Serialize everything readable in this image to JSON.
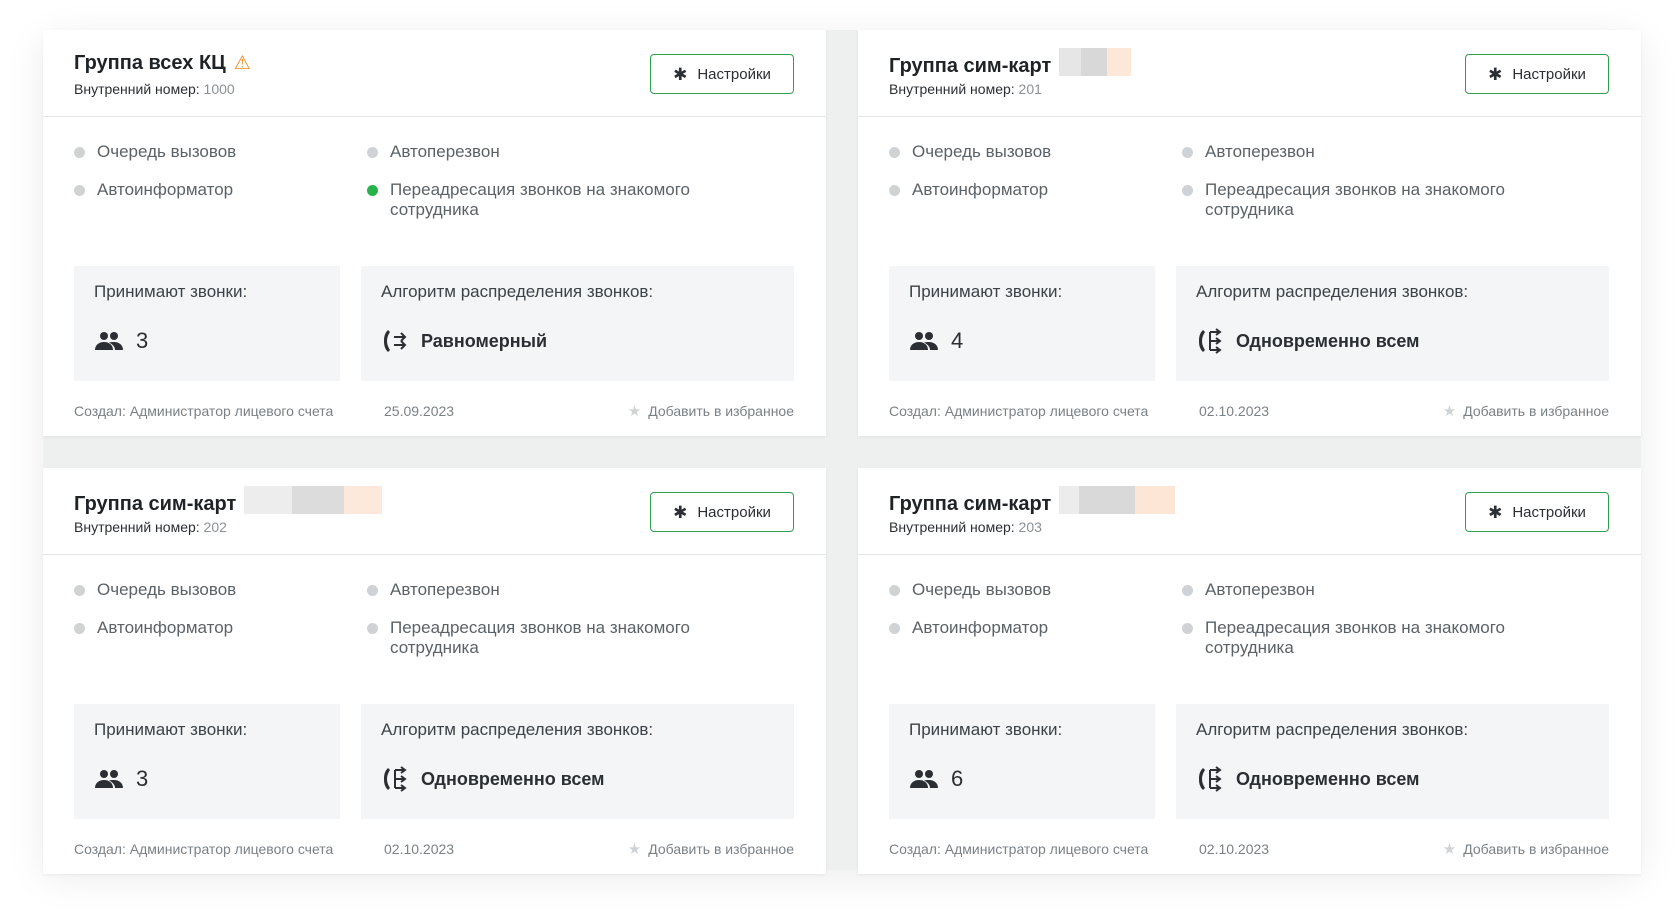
{
  "cards": [
    {
      "title": "Группа всех КЦ",
      "has_warning": true,
      "internal_label": "Внутренний номер:",
      "internal_number": "1000",
      "settings_label": "Настройки",
      "features": [
        {
          "label": "Очередь вызовов",
          "active": false
        },
        {
          "label": "Автоперезвон",
          "active": false
        },
        {
          "label": "Автоинформатор",
          "active": false
        },
        {
          "label": "Переадресация звонков на знакомого сотрудника",
          "active": true
        }
      ],
      "receivers_label": "Принимают звонки:",
      "receivers_count": "3",
      "algorithm_label": "Алгоритм распределения звонков:",
      "algorithm_value": "Равномерный",
      "algorithm_icon": "uniform-distribution-icon",
      "creator": "Создал: Администратор лицевого счета",
      "date": "25.09.2023",
      "favorite_label": "Добавить в избранное"
    },
    {
      "title": "Группа сим-карт",
      "has_warning": false,
      "internal_label": "Внутренний номер:",
      "internal_number": "201",
      "settings_label": "Настройки",
      "features": [
        {
          "label": "Очередь вызовов",
          "active": false
        },
        {
          "label": "Автоперезвон",
          "active": false
        },
        {
          "label": "Автоинформатор",
          "active": false
        },
        {
          "label": "Переадресация звонков на знакомого сотрудника",
          "active": false
        }
      ],
      "receivers_label": "Принимают звонки:",
      "receivers_count": "4",
      "algorithm_label": "Алгоритм распределения звонков:",
      "algorithm_value": "Одновременно всем",
      "algorithm_icon": "simultaneous-distribution-icon",
      "creator": "Создал: Администратор лицевого счета",
      "date": "02.10.2023",
      "favorite_label": "Добавить в избранное"
    },
    {
      "title": "Группа сим-карт",
      "has_warning": false,
      "internal_label": "Внутренний номер:",
      "internal_number": "202",
      "settings_label": "Настройки",
      "features": [
        {
          "label": "Очередь вызовов",
          "active": false
        },
        {
          "label": "Автоперезвон",
          "active": false
        },
        {
          "label": "Автоинформатор",
          "active": false
        },
        {
          "label": "Переадресация звонков на знакомого сотрудника",
          "active": false
        }
      ],
      "receivers_label": "Принимают звонки:",
      "receivers_count": "3",
      "algorithm_label": "Алгоритм распределения звонков:",
      "algorithm_value": "Одновременно всем",
      "algorithm_icon": "simultaneous-distribution-icon",
      "creator": "Создал: Администратор лицевого счета",
      "date": "02.10.2023",
      "favorite_label": "Добавить в избранное"
    },
    {
      "title": "Группа сим-карт",
      "has_warning": false,
      "internal_label": "Внутренний номер:",
      "internal_number": "203",
      "settings_label": "Настройки",
      "features": [
        {
          "label": "Очередь вызовов",
          "active": false
        },
        {
          "label": "Автоперезвон",
          "active": false
        },
        {
          "label": "Автоинформатор",
          "active": false
        },
        {
          "label": "Переадресация звонков на знакомого сотрудника",
          "active": false
        }
      ],
      "receivers_label": "Принимают звонки:",
      "receivers_count": "6",
      "algorithm_label": "Алгоритм распределения звонков:",
      "algorithm_value": "Одновременно всем",
      "algorithm_icon": "simultaneous-distribution-icon",
      "creator": "Создал: Администратор лицевого счета",
      "date": "02.10.2023",
      "favorite_label": "Добавить в избранное"
    }
  ],
  "colors": {
    "accent_green": "#2e9e4f",
    "active_dot": "#27b34a",
    "inactive_dot": "#cfd3d6",
    "warning": "#f08a24"
  }
}
